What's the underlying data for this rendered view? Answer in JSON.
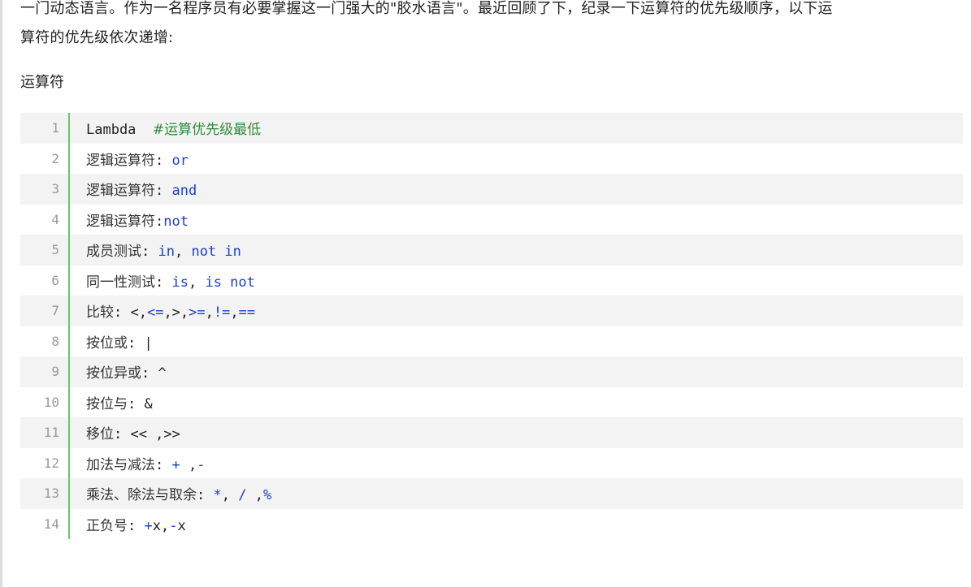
{
  "article": {
    "intro_line1": "一门动态语言。作为一名程序员有必要掌握这一门强大的\"胶水语言\"。最近回顾了下，纪录一下运算符的优先级顺序，以下运",
    "intro_line2": "算符的优先级依次递增:",
    "heading": "运算符"
  },
  "code": {
    "lines": [
      {
        "no": "1",
        "parts": [
          {
            "t": "Lambda  ",
            "c": "plain"
          },
          {
            "t": "#运算优先级最低",
            "c": "cm"
          }
        ]
      },
      {
        "no": "2",
        "parts": [
          {
            "t": "逻辑运算符",
            "c": "cn"
          },
          {
            "t": ": ",
            "c": "plain"
          },
          {
            "t": "or",
            "c": "kw"
          }
        ]
      },
      {
        "no": "3",
        "parts": [
          {
            "t": "逻辑运算符",
            "c": "cn"
          },
          {
            "t": ": ",
            "c": "plain"
          },
          {
            "t": "and",
            "c": "kw"
          }
        ]
      },
      {
        "no": "4",
        "parts": [
          {
            "t": "逻辑运算符",
            "c": "cn"
          },
          {
            "t": ":",
            "c": "plain"
          },
          {
            "t": "not",
            "c": "kw"
          }
        ]
      },
      {
        "no": "5",
        "parts": [
          {
            "t": "成员测试",
            "c": "cn"
          },
          {
            "t": ": ",
            "c": "plain"
          },
          {
            "t": "in",
            "c": "kw"
          },
          {
            "t": ", ",
            "c": "plain"
          },
          {
            "t": "not in",
            "c": "kw"
          }
        ]
      },
      {
        "no": "6",
        "parts": [
          {
            "t": "同一性测试",
            "c": "cn"
          },
          {
            "t": ": ",
            "c": "plain"
          },
          {
            "t": "is",
            "c": "kw"
          },
          {
            "t": ", ",
            "c": "plain"
          },
          {
            "t": "is not",
            "c": "kw"
          }
        ]
      },
      {
        "no": "7",
        "parts": [
          {
            "t": "比较",
            "c": "cn"
          },
          {
            "t": ": <,",
            "c": "plain"
          },
          {
            "t": "<=",
            "c": "kw"
          },
          {
            "t": ",>,",
            "c": "plain"
          },
          {
            "t": ">=",
            "c": "kw"
          },
          {
            "t": ",",
            "c": "plain"
          },
          {
            "t": "!=",
            "c": "kw"
          },
          {
            "t": ",",
            "c": "plain"
          },
          {
            "t": "==",
            "c": "kw"
          }
        ]
      },
      {
        "no": "8",
        "parts": [
          {
            "t": "按位或",
            "c": "cn"
          },
          {
            "t": ": |",
            "c": "plain"
          }
        ]
      },
      {
        "no": "9",
        "parts": [
          {
            "t": "按位异或",
            "c": "cn"
          },
          {
            "t": ": ^",
            "c": "plain"
          }
        ]
      },
      {
        "no": "10",
        "parts": [
          {
            "t": "按位与",
            "c": "cn"
          },
          {
            "t": ": &",
            "c": "plain"
          }
        ]
      },
      {
        "no": "11",
        "parts": [
          {
            "t": "移位",
            "c": "cn"
          },
          {
            "t": ": << ,>>",
            "c": "plain"
          }
        ]
      },
      {
        "no": "12",
        "parts": [
          {
            "t": "加法与减法",
            "c": "cn"
          },
          {
            "t": ": ",
            "c": "plain"
          },
          {
            "t": "+",
            "c": "kw"
          },
          {
            "t": " ,",
            "c": "plain"
          },
          {
            "t": "-",
            "c": "kw"
          }
        ]
      },
      {
        "no": "13",
        "parts": [
          {
            "t": "乘法、除法与取余",
            "c": "cn"
          },
          {
            "t": ": ",
            "c": "plain"
          },
          {
            "t": "*",
            "c": "kw"
          },
          {
            "t": ", ",
            "c": "plain"
          },
          {
            "t": "/",
            "c": "kw"
          },
          {
            "t": " ,",
            "c": "plain"
          },
          {
            "t": "%",
            "c": "kw"
          }
        ]
      },
      {
        "no": "14",
        "parts": [
          {
            "t": "正负号",
            "c": "cn"
          },
          {
            "t": ": ",
            "c": "plain"
          },
          {
            "t": "+",
            "c": "kw"
          },
          {
            "t": "x,",
            "c": "plain"
          },
          {
            "t": "-",
            "c": "kw"
          },
          {
            "t": "x",
            "c": "plain"
          }
        ]
      }
    ]
  },
  "colors": {
    "keyword": "#1a3fd1",
    "comment": "#2e8b3a",
    "gutter_rule": "#6cc46c",
    "stripe": "#f3f3f3"
  }
}
